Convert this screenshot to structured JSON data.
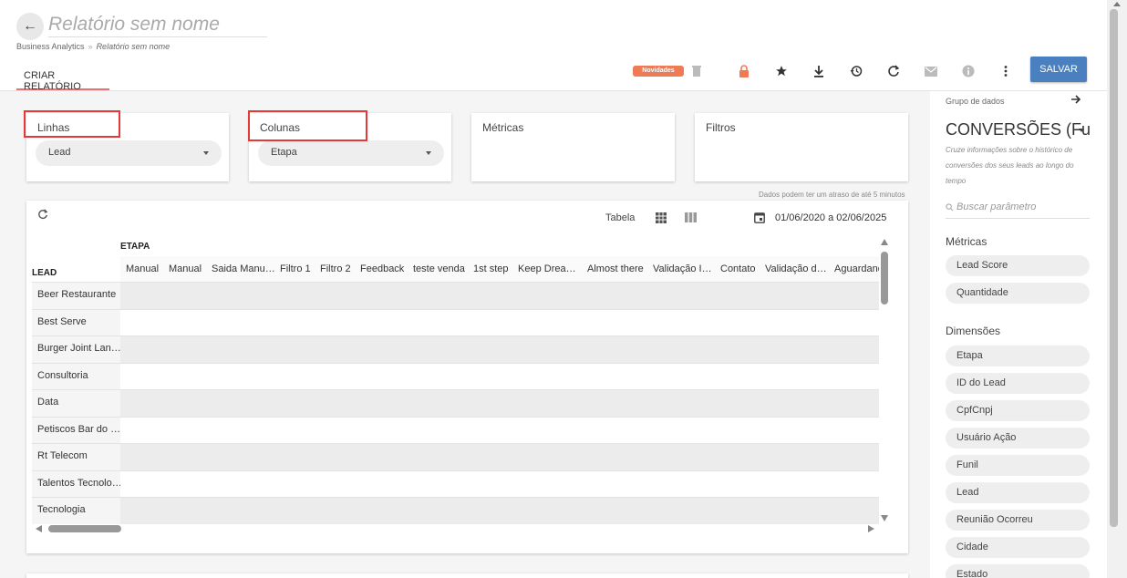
{
  "header": {
    "title": "Relatório sem nome",
    "breadcrumb": {
      "root": "Business Analytics",
      "separator": "»",
      "current": "Relatório sem nome"
    },
    "tab": "CRIAR RELATÓRIO",
    "badge": "Novidades",
    "save_label": "SALVAR",
    "icons": [
      "trash-icon",
      "lock-icon",
      "star-icon",
      "download-icon",
      "history-icon",
      "refresh-icon",
      "email-icon",
      "info-icon",
      "more-vertical-icon"
    ],
    "colors": {
      "accent": "#4a7fc0",
      "badge": "#ef7b54",
      "lock": "#ef7b54",
      "highlight": "#e53935"
    }
  },
  "config": {
    "linhas": {
      "title": "Linhas",
      "value": "Lead"
    },
    "colunas": {
      "title": "Colunas",
      "value": "Etapa"
    },
    "metricas": {
      "title": "Métricas"
    },
    "filtros": {
      "title": "Filtros"
    },
    "delay_note": "Dados podem ter um atraso de até 5 minutos"
  },
  "table": {
    "view_label": "Tabela",
    "date_range": "01/06/2020 a 02/06/2025",
    "column_group": "ETAPA",
    "row_group": "LEAD",
    "columns": [
      "Manual",
      "Manual",
      "Saida Manu…",
      "Filtro 1",
      "Filtro 2",
      "Feedback",
      "teste venda",
      "1st step",
      "Keep Drea…",
      "Almost there",
      "Validação I…",
      "Contato",
      "Validação d…",
      "Aguardand"
    ],
    "rows": [
      "Beer Restaurante",
      "Best Serve",
      "Burger Joint Lan…",
      "Consultoria",
      "Data",
      "Petiscos Bar do …",
      "Rt Telecom",
      "Talentos Tecnolo…",
      "Tecnologia"
    ]
  },
  "sidebar": {
    "group_label": "Grupo de dados",
    "group_value": "CONVERSÕES (Fu",
    "description": "Cruze informações sobre o histórico de conversões dos seus leads ao longo do tempo",
    "search_placeholder": "Buscar parâmetro",
    "metrics_title": "Métricas",
    "metrics": [
      "Lead Score",
      "Quantidade"
    ],
    "dimensions_title": "Dimensões",
    "dimensions": [
      "Etapa",
      "ID do Lead",
      "CpfCnpj",
      "Usuário Ação",
      "Funil",
      "Lead",
      "Reunião Ocorreu",
      "Cidade",
      "Estado"
    ]
  }
}
